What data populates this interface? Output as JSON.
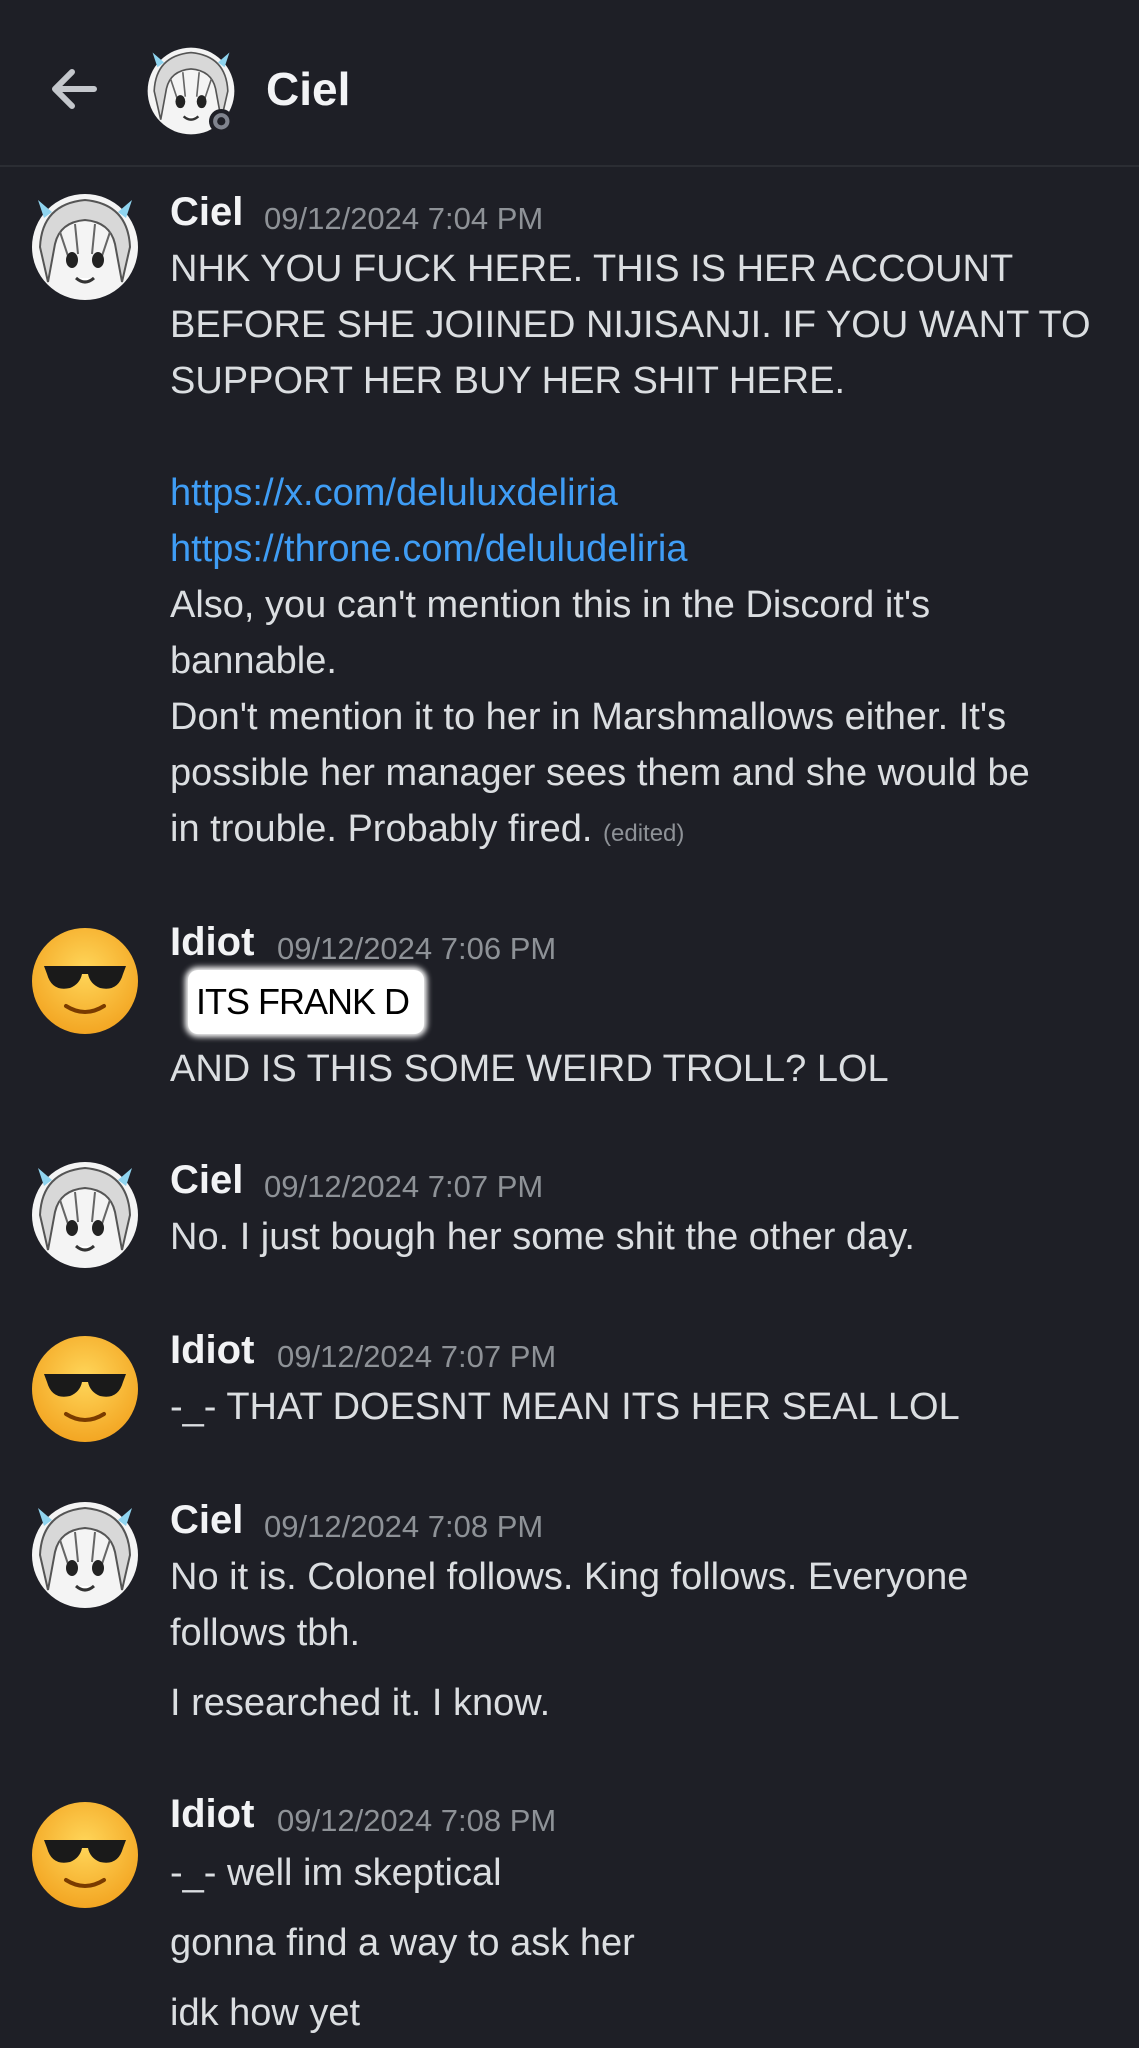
{
  "header": {
    "back_icon": "arrow-left-icon",
    "title": "Ciel"
  },
  "messages": [
    {
      "author": "Ciel",
      "timestamp": "09/12/2024 7:04 PM",
      "lines": [
        "NHK YOU FUCK HERE. THIS IS HER ACCOUNT",
        "BEFORE SHE JOIINED NIJISANJI. IF YOU WANT TO",
        "SUPPORT HER BUY HER SHIT HERE."
      ],
      "links": [
        "https://x.com/deluluxdeliria",
        "https://throne.com/deluludeliria"
      ],
      "after": [
        "Also, you can't mention this in the Discord it's",
        "bannable.",
        "Don't mention it to her in Marshmallows either. It's",
        "possible her manager sees them and she would be",
        "in trouble. Probably fired."
      ],
      "edited": "(edited)"
    },
    {
      "author": "Idiot",
      "timestamp": "09/12/2024 7:06 PM",
      "redacted_text": "ITS FRANK D",
      "lines": [
        "AND IS THIS SOME WEIRD TROLL? LOL"
      ]
    },
    {
      "author": "Ciel",
      "timestamp": "09/12/2024 7:07 PM",
      "lines": [
        "No. I just bough her some shit the other day."
      ]
    },
    {
      "author": "Idiot",
      "timestamp": "09/12/2024 7:07 PM",
      "lines": [
        "-_- THAT DOESNT MEAN ITS HER SEAL LOL"
      ]
    },
    {
      "author": "Ciel",
      "timestamp": "09/12/2024 7:08 PM",
      "lines": [
        "No it is. Colonel follows. King follows. Everyone",
        "follows tbh.",
        "I researched it. I know."
      ]
    },
    {
      "author": "Idiot",
      "timestamp": "09/12/2024 7:08 PM",
      "lines": [
        "-_- well im skeptical",
        "gonna find a way to ask her",
        "idk how yet"
      ]
    }
  ]
}
